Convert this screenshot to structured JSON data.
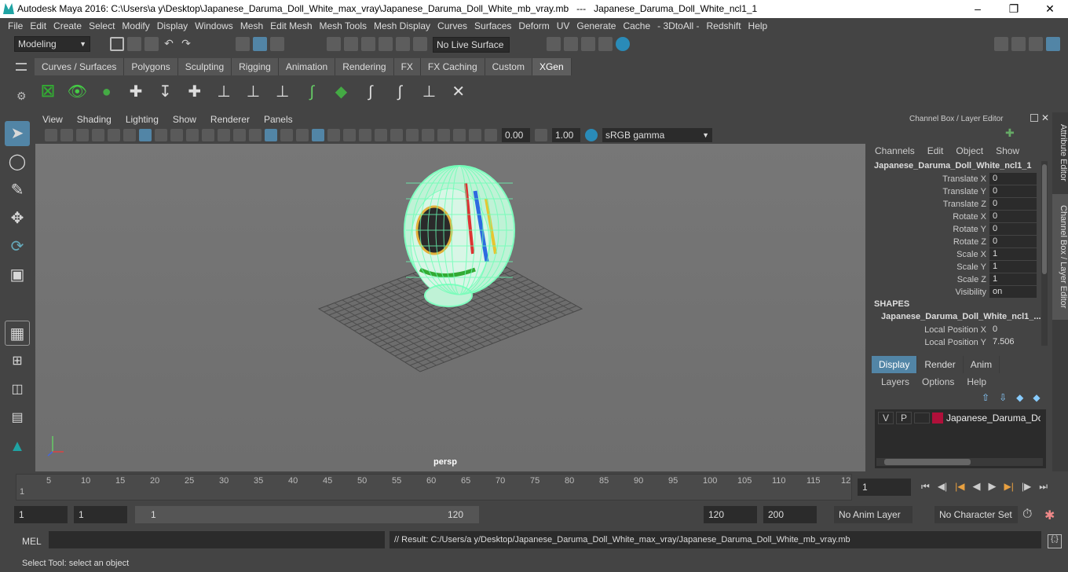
{
  "title": "Autodesk Maya 2016: C:\\Users\\a y\\Desktop\\Japanese_Daruma_Doll_White_max_vray\\Japanese_Daruma_Doll_White_mb_vray.mb   ---   Japanese_Daruma_Doll_White_ncl1_1",
  "menu": [
    "File",
    "Edit",
    "Create",
    "Select",
    "Modify",
    "Display",
    "Windows",
    "Mesh",
    "Edit Mesh",
    "Mesh Tools",
    "Mesh Display",
    "Curves",
    "Surfaces",
    "Deform",
    "UV",
    "Generate",
    "Cache",
    "- 3DtoAll -",
    "Redshift",
    "Help"
  ],
  "status": {
    "mode": "Modeling",
    "live_surface": "No Live Surface"
  },
  "shelf_tabs": [
    "Curves / Surfaces",
    "Polygons",
    "Sculpting",
    "Rigging",
    "Animation",
    "Rendering",
    "FX",
    "FX Caching",
    "Custom",
    "XGen"
  ],
  "active_shelf": "XGen",
  "panel_menu": [
    "View",
    "Shading",
    "Lighting",
    "Show",
    "Renderer",
    "Panels"
  ],
  "panel_fields": {
    "exposure": "0.00",
    "gamma": "1.00",
    "color_space": "sRGB gamma"
  },
  "camera_label": "persp",
  "channel_box": {
    "header": "Channel Box / Layer Editor",
    "menu": [
      "Channels",
      "Edit",
      "Object",
      "Show"
    ],
    "object": "Japanese_Daruma_Doll_White_ncl1_1",
    "channels": [
      {
        "name": "Translate X",
        "value": "0"
      },
      {
        "name": "Translate Y",
        "value": "0"
      },
      {
        "name": "Translate Z",
        "value": "0"
      },
      {
        "name": "Rotate X",
        "value": "0"
      },
      {
        "name": "Rotate Y",
        "value": "0"
      },
      {
        "name": "Rotate Z",
        "value": "0"
      },
      {
        "name": "Scale X",
        "value": "1"
      },
      {
        "name": "Scale Y",
        "value": "1"
      },
      {
        "name": "Scale Z",
        "value": "1"
      },
      {
        "name": "Visibility",
        "value": "on"
      }
    ],
    "shapes_label": "SHAPES",
    "shape_name": "Japanese_Daruma_Doll_White_ncl1_...",
    "shape_channels": [
      {
        "name": "Local Position X",
        "value": "0"
      },
      {
        "name": "Local Position Y",
        "value": "7.506"
      }
    ]
  },
  "layer_editor": {
    "tabs": [
      "Display",
      "Render",
      "Anim"
    ],
    "menu": [
      "Layers",
      "Options",
      "Help"
    ],
    "layer": {
      "v": "V",
      "p": "P",
      "name": "Japanese_Daruma_Doll_W",
      "color": "#b0103a"
    }
  },
  "side_tabs": [
    "Attribute Editor",
    "Channel Box / Layer Editor"
  ],
  "timeline": {
    "ticks": [
      "5",
      "10",
      "15",
      "20",
      "25",
      "30",
      "35",
      "40",
      "45",
      "50",
      "55",
      "60",
      "65",
      "70",
      "75",
      "80",
      "85",
      "90",
      "95",
      "100",
      "105",
      "110",
      "115",
      "12"
    ],
    "first_frame": "1",
    "current_frame": "1"
  },
  "range": {
    "start": "1",
    "anim_start": "1",
    "slider_start": "1",
    "slider_end": "120",
    "end": "120",
    "anim_end": "200",
    "anim_layer": "No Anim Layer",
    "character_set": "No Character Set"
  },
  "command": {
    "lang": "MEL",
    "result": "// Result: C:/Users/a y/Desktop/Japanese_Daruma_Doll_White_max_vray/Japanese_Daruma_Doll_White_mb_vray.mb"
  },
  "help_line": "Select Tool: select an object"
}
